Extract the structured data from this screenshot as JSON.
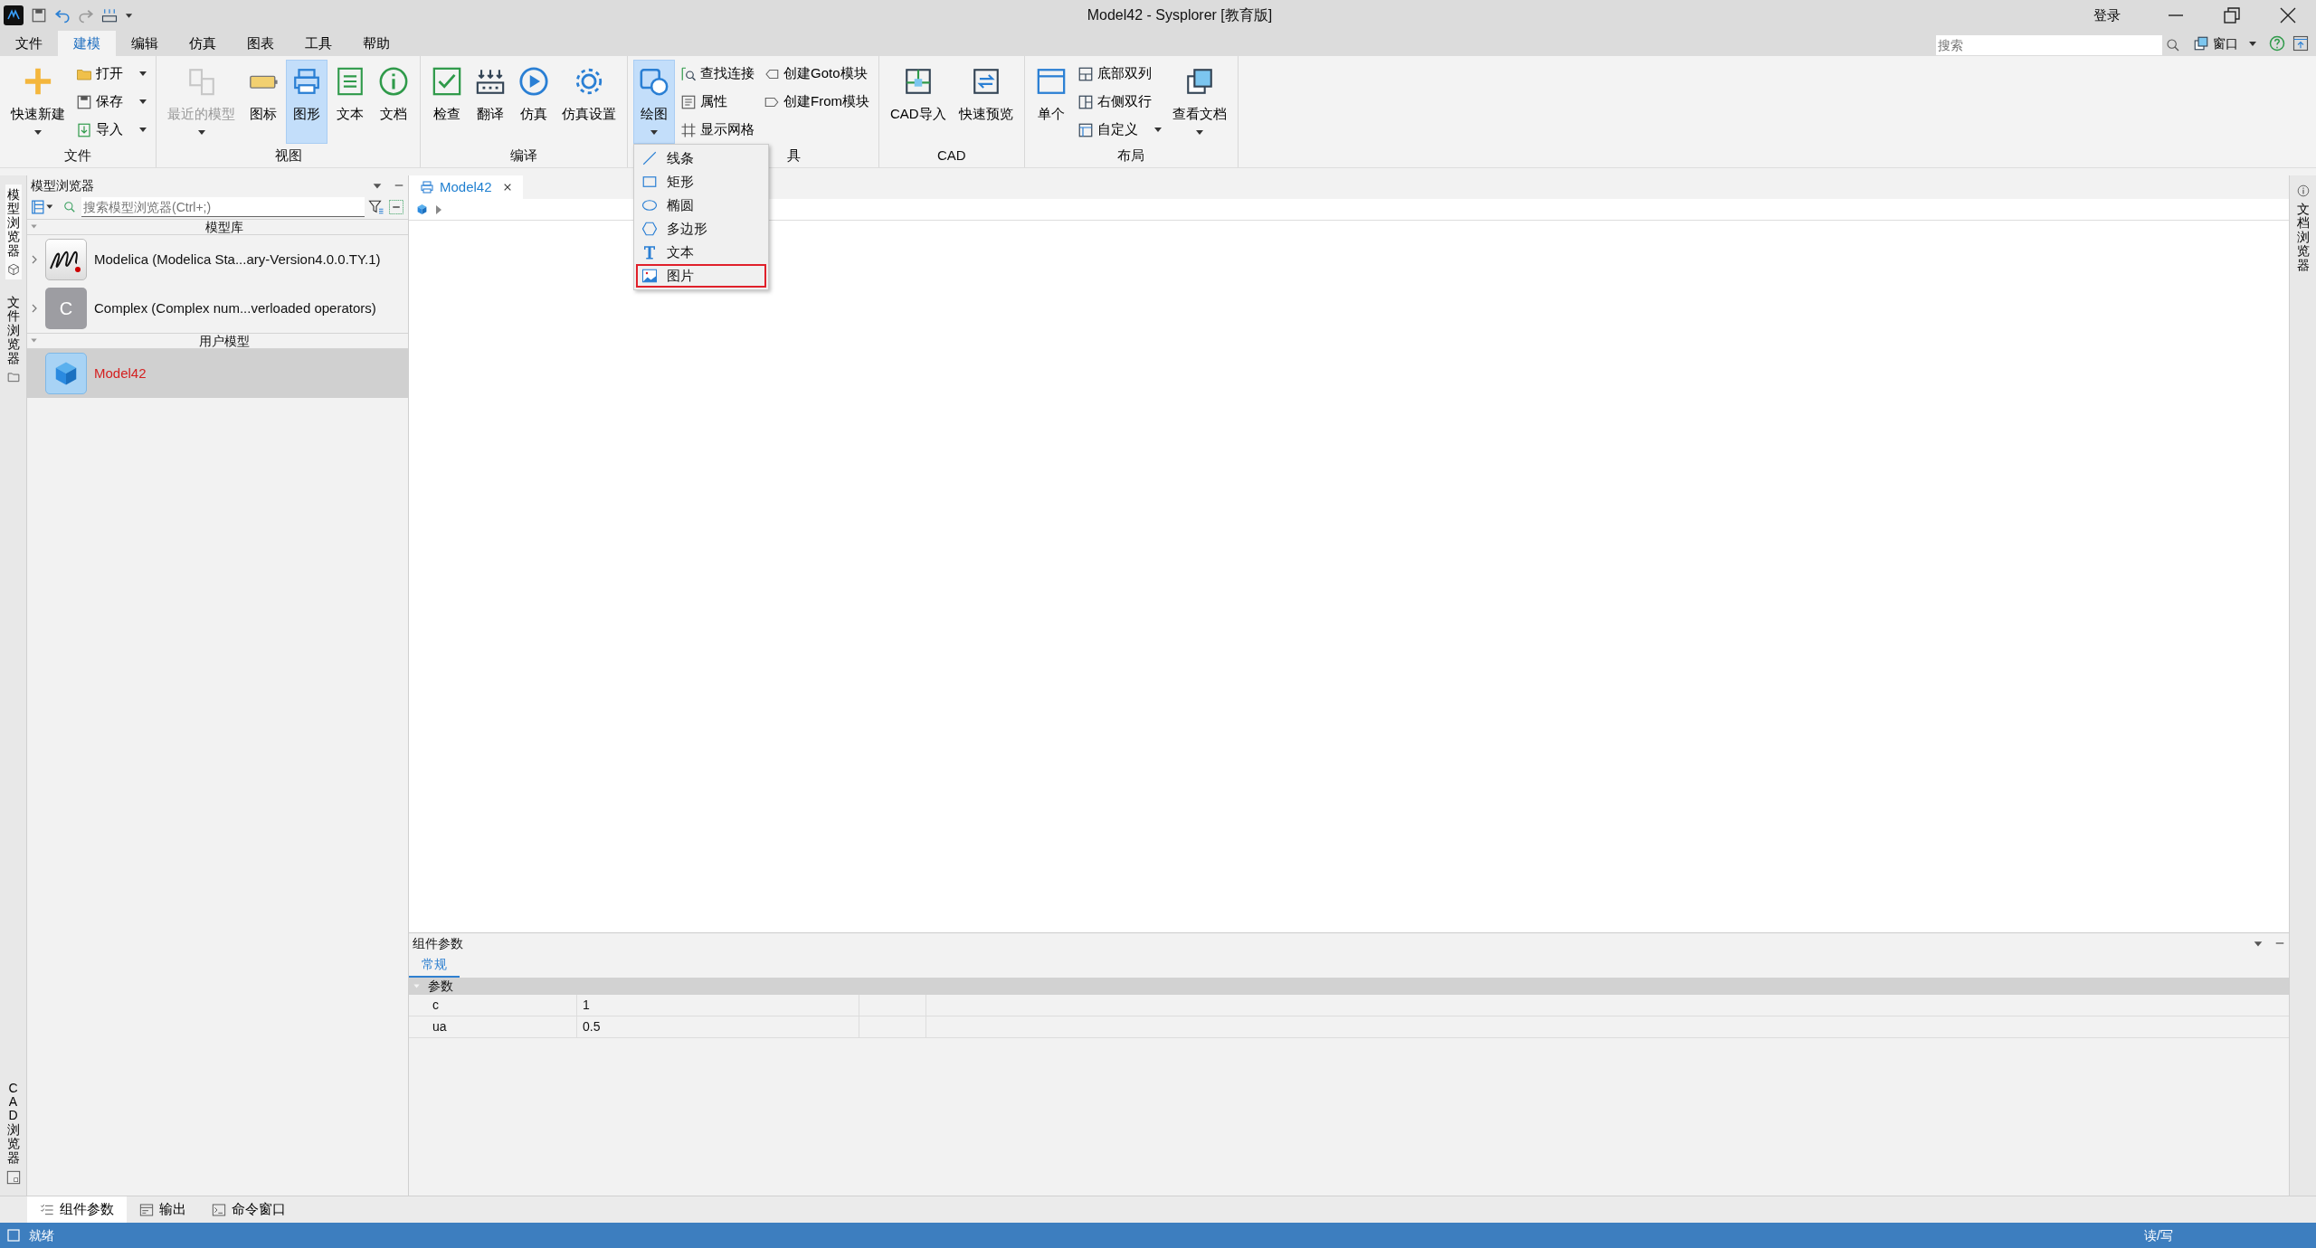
{
  "window": {
    "title": "Model42 - Sysplorer [教育版]",
    "login": "登录"
  },
  "menu_tabs": [
    {
      "label": "文件",
      "selected": false
    },
    {
      "label": "建模",
      "selected": true
    },
    {
      "label": "编辑",
      "selected": false
    },
    {
      "label": "仿真",
      "selected": false
    },
    {
      "label": "图表",
      "selected": false
    },
    {
      "label": "工具",
      "selected": false
    },
    {
      "label": "帮助",
      "selected": false
    }
  ],
  "search": {
    "placeholder": "搜索"
  },
  "window_menu": {
    "label": "窗口"
  },
  "ribbon_groups": [
    {
      "label": "文件",
      "items": [
        {
          "label": "快速新建",
          "kind": "large",
          "selected": false,
          "disabled": false,
          "dropdown": true
        },
        {
          "label": "打开",
          "kind": "small",
          "selected": false,
          "disabled": false,
          "dropdown": true
        },
        {
          "label": "保存",
          "kind": "small",
          "selected": false,
          "disabled": false,
          "dropdown": true
        },
        {
          "label": "导入",
          "kind": "small",
          "selected": false,
          "disabled": false,
          "dropdown": true
        }
      ]
    },
    {
      "label": "视图",
      "items": [
        {
          "label": "最近的模型",
          "kind": "large",
          "selected": false,
          "disabled": true,
          "dropdown": true
        },
        {
          "label": "图标",
          "kind": "large",
          "selected": false,
          "disabled": false,
          "dropdown": false
        },
        {
          "label": "图形",
          "kind": "large",
          "selected": true,
          "disabled": false,
          "dropdown": false
        },
        {
          "label": "文本",
          "kind": "large",
          "selected": false,
          "disabled": false,
          "dropdown": false
        },
        {
          "label": "文档",
          "kind": "large",
          "selected": false,
          "disabled": false,
          "dropdown": false
        }
      ]
    },
    {
      "label": "编译",
      "items": [
        {
          "label": "检查",
          "kind": "large",
          "selected": false,
          "disabled": false,
          "dropdown": false
        },
        {
          "label": "翻译",
          "kind": "large",
          "selected": false,
          "disabled": false,
          "dropdown": false
        },
        {
          "label": "仿真",
          "kind": "large",
          "selected": false,
          "disabled": false,
          "dropdown": false
        },
        {
          "label": "仿真设置",
          "kind": "large",
          "selected": false,
          "disabled": false,
          "dropdown": false
        }
      ]
    },
    {
      "label": "具",
      "items": [
        {
          "label": "绘图",
          "kind": "large",
          "selected": true,
          "disabled": false,
          "dropdown": true,
          "menu": [
            {
              "label": "线条",
              "selected": false
            },
            {
              "label": "矩形",
              "selected": false
            },
            {
              "label": "椭圆",
              "selected": false
            },
            {
              "label": "多边形",
              "selected": false
            },
            {
              "label": "文本",
              "selected": false
            },
            {
              "label": "图片",
              "selected": true
            }
          ]
        },
        {
          "label": "查找连接",
          "kind": "small",
          "selected": false,
          "disabled": false,
          "dropdown": false
        },
        {
          "label": "属性",
          "kind": "small",
          "selected": false,
          "disabled": false,
          "dropdown": false
        },
        {
          "label": "显示网格",
          "kind": "small",
          "selected": false,
          "disabled": false,
          "dropdown": false
        },
        {
          "label": "创建Goto模块",
          "kind": "small",
          "selected": false,
          "disabled": false,
          "dropdown": false
        },
        {
          "label": "创建From模块",
          "kind": "small",
          "selected": false,
          "disabled": false,
          "dropdown": false
        }
      ]
    },
    {
      "label": "CAD",
      "items": [
        {
          "label": "CAD导入",
          "kind": "large",
          "selected": false,
          "disabled": false,
          "dropdown": false
        },
        {
          "label": "快速预览",
          "kind": "large",
          "selected": false,
          "disabled": false,
          "dropdown": false
        }
      ]
    },
    {
      "label": "布局",
      "items": [
        {
          "label": "单个",
          "kind": "large",
          "selected": false,
          "disabled": false,
          "dropdown": false
        },
        {
          "label": "底部双列",
          "kind": "small",
          "selected": false,
          "disabled": false,
          "dropdown": false
        },
        {
          "label": "右侧双行",
          "kind": "small",
          "selected": false,
          "disabled": false,
          "dropdown": false
        },
        {
          "label": "自定义",
          "kind": "small",
          "selected": false,
          "disabled": false,
          "dropdown": true
        },
        {
          "label": "查看文档",
          "kind": "large",
          "selected": false,
          "disabled": false,
          "dropdown": true
        }
      ]
    }
  ],
  "left_side_tabs": [
    {
      "label": "模型浏览器",
      "selected": true
    },
    {
      "label": "文件浏览器",
      "selected": false
    }
  ],
  "cad_side_tab": {
    "label": "CAD 浏览器"
  },
  "right_side_tab": {
    "label": "文档浏览器"
  },
  "model_browser": {
    "title": "模型浏览器",
    "search_placeholder": "搜索模型浏览器(Ctrl+;)",
    "sections": [
      {
        "label": "模型库",
        "expanded": true,
        "items": [
          {
            "label": "Modelica (Modelica Sta...ary-Version4.0.0.TY.1)",
            "kind": "logo",
            "selected": false
          },
          {
            "label": "Complex (Complex num...verloaded operators)",
            "kind": "letter",
            "letter": "C",
            "selected": false
          }
        ]
      },
      {
        "label": "用户模型",
        "expanded": true,
        "items": [
          {
            "label": "Model42",
            "kind": "cube",
            "selected": true
          }
        ]
      }
    ]
  },
  "editor_tabs": [
    {
      "label": "Model42",
      "selected": true
    }
  ],
  "parameters": {
    "title": "组件参数",
    "tabs": [
      {
        "label": "常规",
        "selected": true
      }
    ],
    "group": {
      "label": "参数",
      "expanded": true
    },
    "rows": [
      {
        "name": "c",
        "value": "1"
      },
      {
        "name": "ua",
        "value": "0.5"
      }
    ]
  },
  "bottom_tabs": [
    {
      "label": "组件参数",
      "selected": true
    },
    {
      "label": "输出",
      "selected": false
    },
    {
      "label": "命令窗口",
      "selected": false
    }
  ],
  "status_bar": {
    "message": "就绪",
    "mode": "读/写"
  }
}
